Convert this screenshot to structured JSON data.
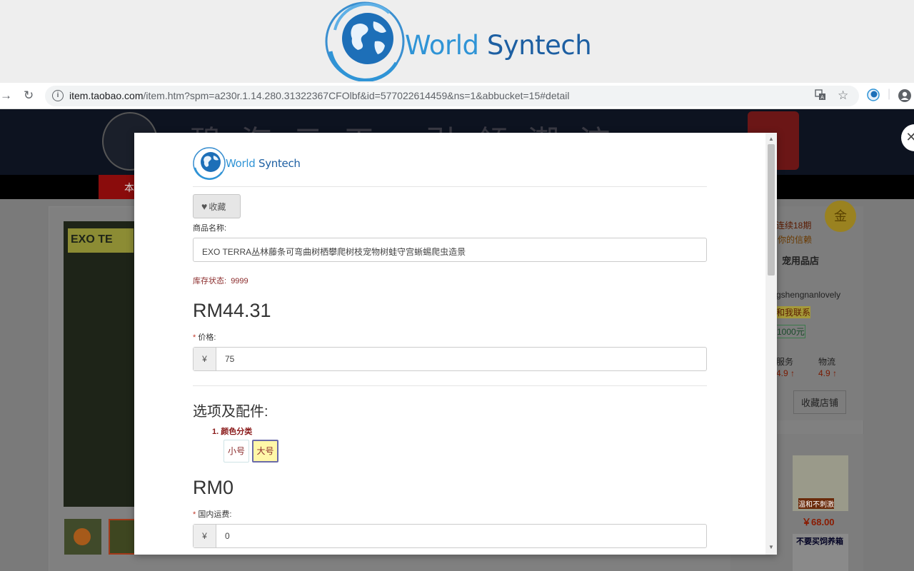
{
  "banner": {
    "brand_word1": "World",
    "brand_word2": "Syntech",
    "globe_icon": "globe-icon"
  },
  "browser": {
    "url_host": "item.taobao.com",
    "url_path": "/item.htm?spm=a230r.1.14.280.31322367CFOlbf&id=577022614459&ns=1&abbucket=15#detail",
    "back_icon": "arrow-right-icon",
    "reload_icon": "reload-icon",
    "info_icon": "info-icon",
    "translate_icon": "translate-icon",
    "star_icon": "star-icon",
    "extension_icon": "extension-icon",
    "profile_icon": "profile-icon"
  },
  "background_page": {
    "nav_tab": "本",
    "side": {
      "seller_badge": "连续18期",
      "trust_text": "你的信赖",
      "shop_name": "宠用品店",
      "seller_id": "gshengnanlovely",
      "contact": "和我联系",
      "deposit": "1000元",
      "rating_service_label": "服务",
      "rating_service_value": "4.9",
      "rating_logistics_label": "物流",
      "rating_logistics_value": "4.9",
      "favorite_shop": "收藏店铺",
      "medal_text": "金"
    },
    "recommend": {
      "price": "￥68.00",
      "tag": "不要买饲养箱",
      "promo": "温和不刺激"
    },
    "product_label": "EXO TE"
  },
  "modal": {
    "logo_brand_word1": "World",
    "logo_brand_word2": "Syntech",
    "favorite_label": "收藏",
    "product_name_label": "商品名称:",
    "product_name_value": "EXO TERRA丛林藤条可弯曲树栖攀爬树枝宠物树蛙守宫蜥蜴爬虫造景",
    "stock_label": "库存状态:",
    "stock_value": "9999",
    "price_display": "RM44.31",
    "price_label": "价格:",
    "price_required": "*",
    "currency_symbol": "¥",
    "price_value": "75",
    "options_title": "选项及配件:",
    "option_category": "1. 颜色分类",
    "options": [
      "小号",
      "大号"
    ],
    "selected_option": "大号",
    "shipping_display": "RM0",
    "shipping_label": "国内运费:",
    "shipping_required": "*",
    "shipping_value": "0"
  },
  "colors": {
    "brand_light": "#2f94d6",
    "brand_dark": "#1d5fa2",
    "selected_option_bg": "#fff7a8",
    "required": "#c0392b"
  }
}
